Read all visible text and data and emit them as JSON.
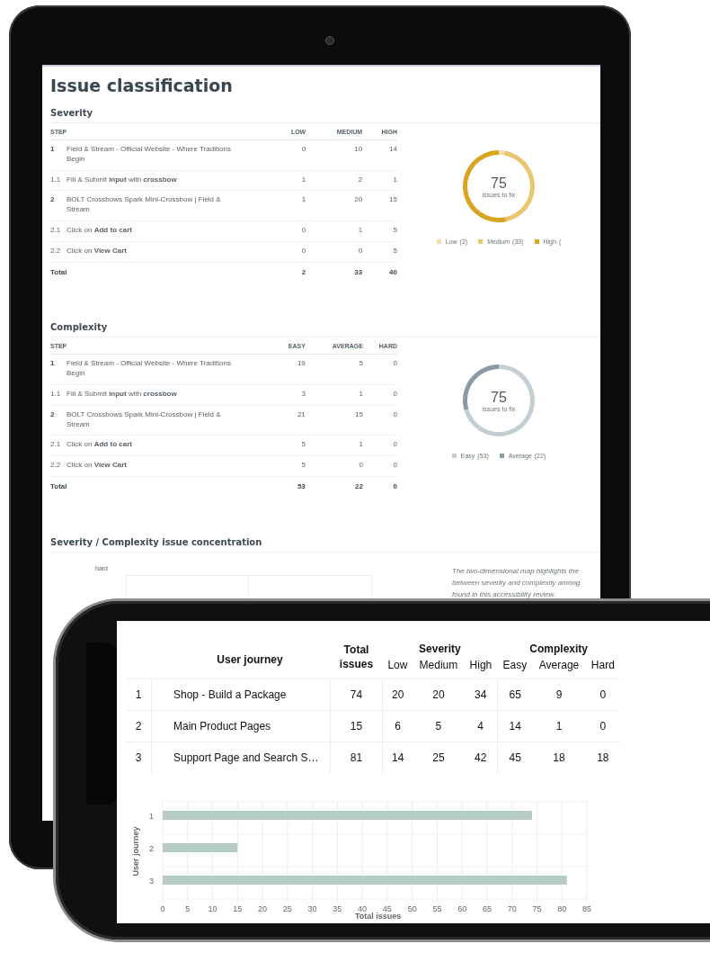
{
  "tablet": {
    "title": "Issue classification",
    "sections": [
      {
        "heading": "Severity",
        "columns": [
          "STEP",
          "LOW",
          "MEDIUM",
          "HIGH"
        ],
        "rows": [
          {
            "kind": "step",
            "step": "1",
            "text": "Field & Stream - Official Website - Where Traditions Begin",
            "values": [
              "0",
              "10",
              "14"
            ]
          },
          {
            "kind": "substep",
            "step": "1.1",
            "text": "Fill & Submit **input** with **crossbow**",
            "values": [
              "1",
              "2",
              "1"
            ]
          },
          {
            "kind": "step",
            "step": "2",
            "text": "BOLT Crossbows Spark Mini-Crossbow | Field & Stream",
            "values": [
              "1",
              "20",
              "15"
            ]
          },
          {
            "kind": "substep",
            "step": "2.1",
            "text": "Click on **Add to cart**",
            "values": [
              "0",
              "1",
              "5"
            ]
          },
          {
            "kind": "substep",
            "step": "2.2",
            "text": "Click on **View Cart**",
            "values": [
              "0",
              "0",
              "5"
            ]
          }
        ],
        "total": {
          "label": "Total",
          "values": [
            "2",
            "33",
            "40"
          ]
        },
        "donut": {
          "value": "75",
          "caption": "issues to fix",
          "chart_data": {
            "type": "donut",
            "categories": [
              "Low",
              "Medium",
              "High"
            ],
            "values": [
              2.67,
              44,
              53.33
            ]
          },
          "legend": [
            {
              "count": "(2)",
              "color": "#f2dfab"
            },
            {
              "count": "(33)",
              "color": "#e9c66d"
            },
            {
              "count": "(",
              "color": "#d9a422"
            }
          ]
        }
      },
      {
        "heading": "Complexity",
        "columns": [
          "STEP",
          "EASY",
          "AVERAGE",
          "HARD"
        ],
        "rows": [
          {
            "kind": "step",
            "step": "1",
            "text": "Field & Stream - Official Website - Where Traditions Begin",
            "values": [
              "19",
              "5",
              "0"
            ]
          },
          {
            "kind": "substep",
            "step": "1.1",
            "text": "Fill & Submit **input** with **crossbow**",
            "values": [
              "3",
              "1",
              "0"
            ]
          },
          {
            "kind": "step",
            "step": "2",
            "text": "BOLT Crossbows Spark Mini-Crossbow | Field & Stream",
            "values": [
              "21",
              "15",
              "0"
            ]
          },
          {
            "kind": "substep",
            "step": "2.1",
            "text": "Click on **Add to cart**",
            "values": [
              "5",
              "1",
              "0"
            ]
          },
          {
            "kind": "substep",
            "step": "2.2",
            "text": "Click on **View Cart**",
            "values": [
              "5",
              "0",
              "0"
            ]
          }
        ],
        "total": {
          "label": "Total",
          "values": [
            "53",
            "22",
            "0"
          ]
        },
        "donut": {
          "value": "75",
          "caption": "issues to fix",
          "chart_data": {
            "type": "donut",
            "categories": [
              "Easy",
              "Average"
            ],
            "values": [
              70.67,
              29.33
            ]
          },
          "legend": [
            {
              "count": "(53)",
              "color": "#c3ced3"
            },
            {
              "count": "(22)",
              "color": "#8a9aa2"
            }
          ]
        }
      }
    ],
    "concentration": {
      "heading": "Severity / Complexity issue concentration",
      "axis_label": "hard",
      "description_lines": [
        "The two-dimensional map highlights the",
        "between severity and complexity among",
        "found in this accessibility review."
      ]
    }
  },
  "phone": {
    "table": {
      "journey_heading": "User journey",
      "total_heading": "Total issues",
      "groups": [
        {
          "label": "Severity",
          "columns": [
            "Low",
            "Medium",
            "High"
          ]
        },
        {
          "label": "Complexity",
          "columns": [
            "Easy",
            "Average",
            "Hard"
          ]
        }
      ],
      "rows": [
        {
          "index": "1",
          "journey": "Shop - Build a Package",
          "total": "74",
          "values": [
            "20",
            "20",
            "34",
            "65",
            "9",
            "0"
          ]
        },
        {
          "index": "2",
          "journey": "Main Product Pages",
          "total": "15",
          "values": [
            "6",
            "5",
            "4",
            "14",
            "1",
            "0"
          ]
        },
        {
          "index": "3",
          "journey": "Support Page and Search S…",
          "total": "81",
          "values": [
            "14",
            "25",
            "42",
            "45",
            "18",
            "18"
          ]
        }
      ]
    },
    "chart_data": {
      "type": "bar",
      "orientation": "horizontal",
      "xlabel": "Total issues",
      "ylabel": "User journey",
      "categories": [
        "1",
        "2",
        "3"
      ],
      "values": [
        74,
        15,
        81
      ],
      "grid": true,
      "xlim": [
        0,
        85
      ],
      "xticks": [
        0,
        5,
        10,
        15,
        20,
        25,
        30,
        35,
        40,
        45,
        50,
        55,
        60,
        65,
        70,
        75,
        80,
        85
      ]
    }
  }
}
